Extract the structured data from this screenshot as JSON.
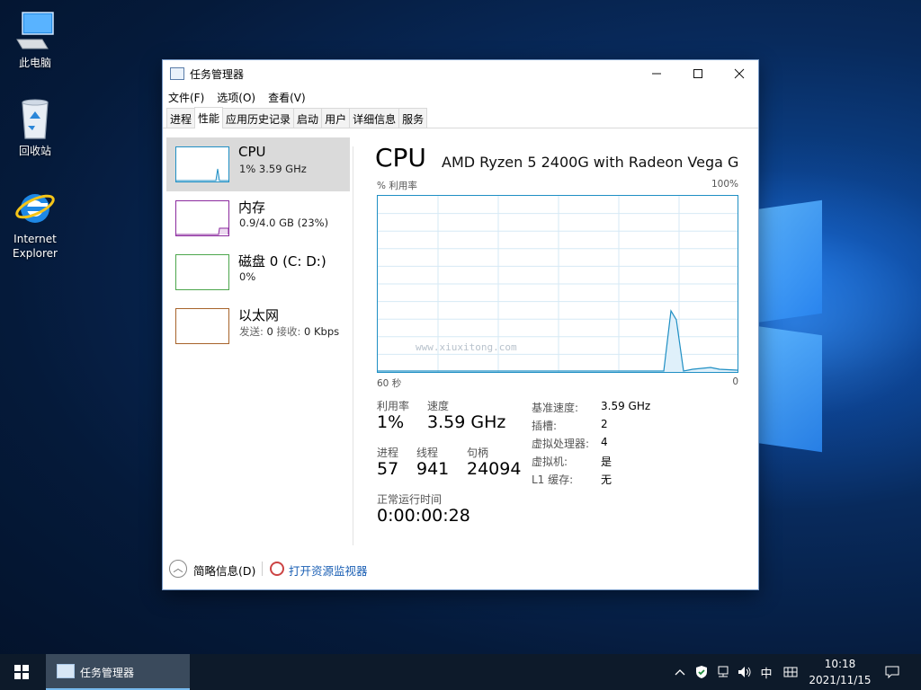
{
  "desktop": {
    "icons": [
      {
        "label": "此电脑",
        "icon": "computer-icon"
      },
      {
        "label": "回收站",
        "icon": "recycle-bin-icon"
      },
      {
        "label": "Internet Explorer",
        "icon": "internet-explorer-icon"
      }
    ]
  },
  "window": {
    "title": "任务管理器",
    "controls": {
      "minimize": "—",
      "maximize": "☐",
      "close": "✕"
    },
    "menu": [
      "文件(F)",
      "选项(O)",
      "查看(V)"
    ],
    "tabs": [
      "进程",
      "性能",
      "应用历史记录",
      "启动",
      "用户",
      "详细信息",
      "服务"
    ],
    "active_tab": "性能"
  },
  "resources": [
    {
      "title": "CPU",
      "sub": "1% 3.59 GHz",
      "color": "#1f8fc4",
      "selected": true
    },
    {
      "title": "内存",
      "sub": "0.9/4.0 GB (23%)",
      "color": "#8b2a9e",
      "selected": false
    },
    {
      "title": "磁盘 0 (C: D:)",
      "sub": "0%",
      "color": "#4ca64c",
      "selected": false
    },
    {
      "title": "以太网",
      "sub_send_label": "发送:",
      "sub_send": "0",
      "sub_recv_label": "接收:",
      "sub_recv": "0 Kbps",
      "color": "#a7632a",
      "selected": false
    }
  ],
  "detail": {
    "heading": "CPU",
    "processor": "AMD Ryzen 5 2400G with Radeon Vega G...",
    "graph_label": "% 利用率",
    "graph_max": "100%",
    "time_left": "60 秒",
    "time_right": "0",
    "watermark": "www.xiuxitong.com",
    "stats": {
      "util_label": "利用率",
      "util_value": "1%",
      "speed_label": "速度",
      "speed_value": "3.59 GHz",
      "proc_label": "进程",
      "proc_value": "57",
      "thread_label": "线程",
      "thread_value": "941",
      "handle_label": "句柄",
      "handle_value": "24094",
      "uptime_label": "正常运行时间",
      "uptime_value": "0:00:00:28"
    },
    "specs": [
      {
        "label": "基准速度:",
        "value": "3.59 GHz"
      },
      {
        "label": "插槽:",
        "value": "2"
      },
      {
        "label": "虚拟处理器:",
        "value": "4"
      },
      {
        "label": "虚拟机:",
        "value": "是"
      },
      {
        "label": "L1 缓存:",
        "value": "无"
      }
    ]
  },
  "footer": {
    "brief": "简略信息(D)",
    "resmon": "打开资源监视器"
  },
  "taskbar": {
    "app_label": "任务管理器",
    "ime": "中",
    "time": "10:18",
    "date": "2021/11/15"
  }
}
